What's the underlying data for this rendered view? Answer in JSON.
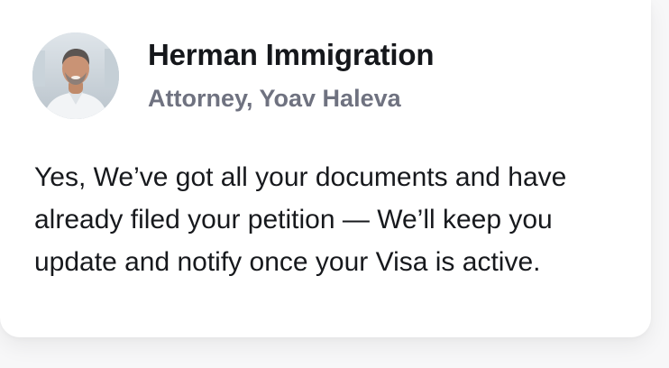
{
  "sender": {
    "name": "Herman Immigration",
    "subtitle": "Attorney, Yoav Haleva",
    "avatar_icon": "person-photo-avatar"
  },
  "message": {
    "text": "Yes, We’ve got all your documents and have already filed your petition — We’ll keep you update and notify once your Visa is active."
  },
  "colors": {
    "card_background": "#ffffff",
    "name_color": "#15171b",
    "subtitle_color": "#6f7280",
    "message_color": "#17191d"
  }
}
